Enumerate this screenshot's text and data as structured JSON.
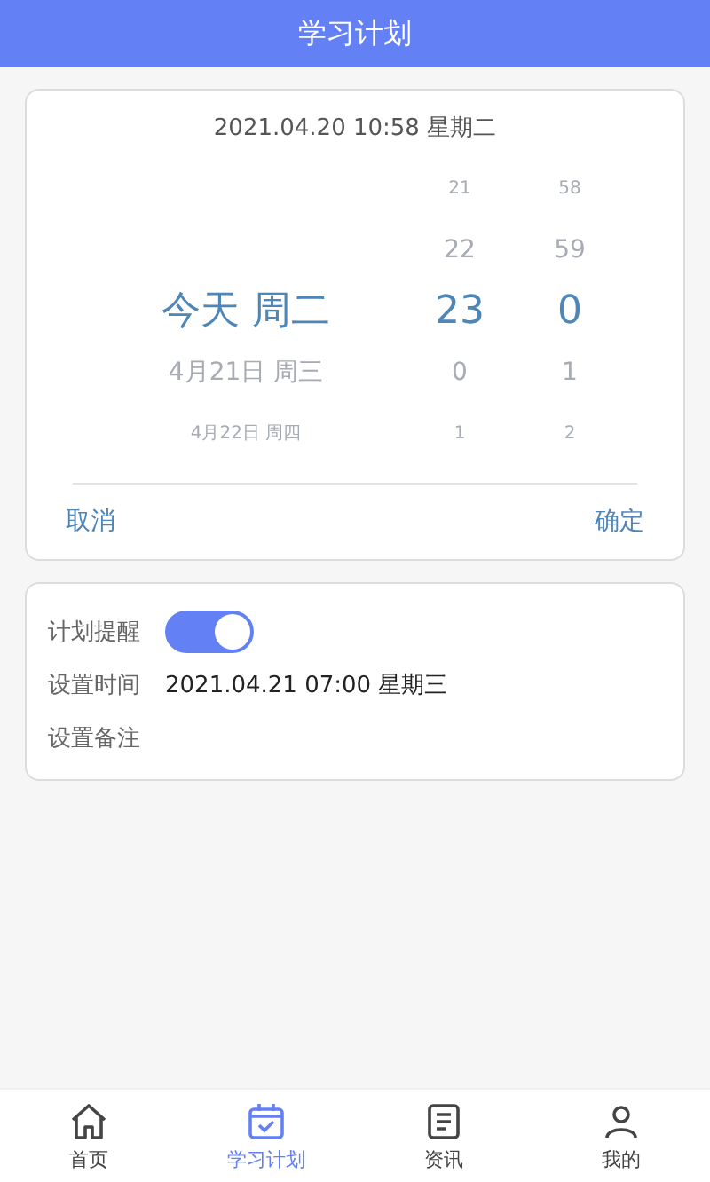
{
  "header": {
    "title": "学习计划"
  },
  "picker": {
    "current_time": "2021.04.20 10:58 星期二",
    "rows": [
      {
        "hour": "21",
        "minute": "58",
        "selected": false
      },
      {
        "hour": "22",
        "minute": "59",
        "selected": false
      },
      {
        "date": "今天 周二",
        "hour": "23",
        "minute": "0",
        "selected": true
      },
      {
        "date": "4月21日 周三",
        "hour": "0",
        "minute": "1",
        "selected": false
      },
      {
        "date": "4月22日 周四",
        "hour": "1",
        "minute": "2",
        "selected": false
      }
    ],
    "cancel": "取消",
    "confirm": "确定"
  },
  "settings": {
    "reminder": {
      "label": "计划提醒",
      "on": true
    },
    "time": {
      "label": "设置时间",
      "value": "2021.04.21 07:00 星期三"
    },
    "note": {
      "label": "设置备注"
    }
  },
  "tabs": [
    {
      "label": "首页",
      "selected": false
    },
    {
      "label": "学习计划",
      "selected": true
    },
    {
      "label": "资讯",
      "selected": false
    },
    {
      "label": "我的",
      "selected": false
    }
  ]
}
